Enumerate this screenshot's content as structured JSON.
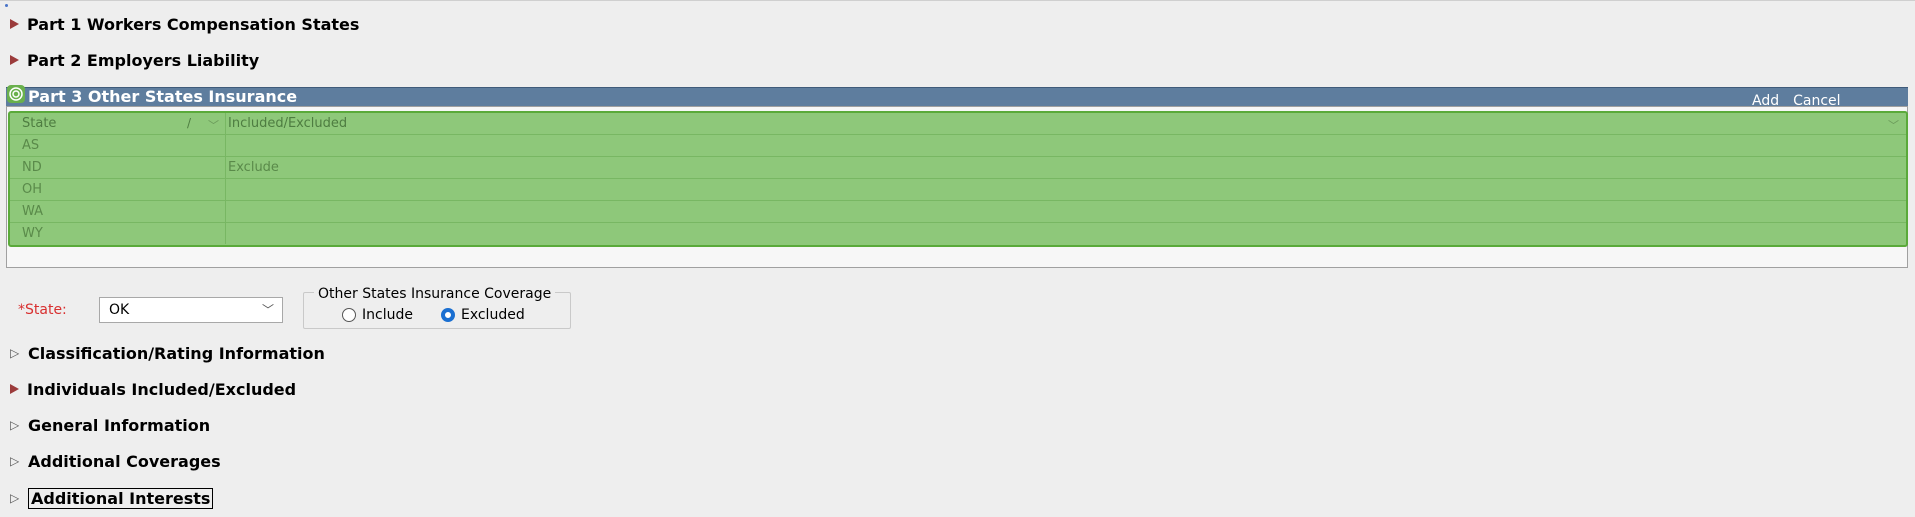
{
  "sections": {
    "part1": "Part 1 Workers Compensation States",
    "part2": "Part 2 Employers Liability",
    "part3": "Part 3 Other States Insurance",
    "classification": "Classification/Rating Information",
    "individuals": "Individuals Included/Excluded",
    "general": "General Information",
    "additional_coverages": "Additional Coverages",
    "additional_interests": "Additional Interests"
  },
  "part3_actions": {
    "add": "Add",
    "cancel": "Cancel"
  },
  "grid": {
    "columns": [
      "State",
      "Included/Excluded"
    ],
    "sort_mark": "/",
    "rows": [
      {
        "state": "AS",
        "included_excluded": ""
      },
      {
        "state": "ND",
        "included_excluded": "Exclude"
      },
      {
        "state": "OH",
        "included_excluded": ""
      },
      {
        "state": "WA",
        "included_excluded": ""
      },
      {
        "state": "WY",
        "included_excluded": ""
      }
    ]
  },
  "state_field": {
    "label": "*State:",
    "value": "OK"
  },
  "coverage": {
    "legend": "Other States Insurance Coverage",
    "options": [
      "Include",
      "Excluded"
    ],
    "selected": "Excluded"
  },
  "colors": {
    "section_arrow": "#9b3b3b",
    "header_bar": "#5e7d9e",
    "highlight_green": "#8ec87a",
    "required_label": "#d83030",
    "radio_selected": "#1a6fd1"
  }
}
